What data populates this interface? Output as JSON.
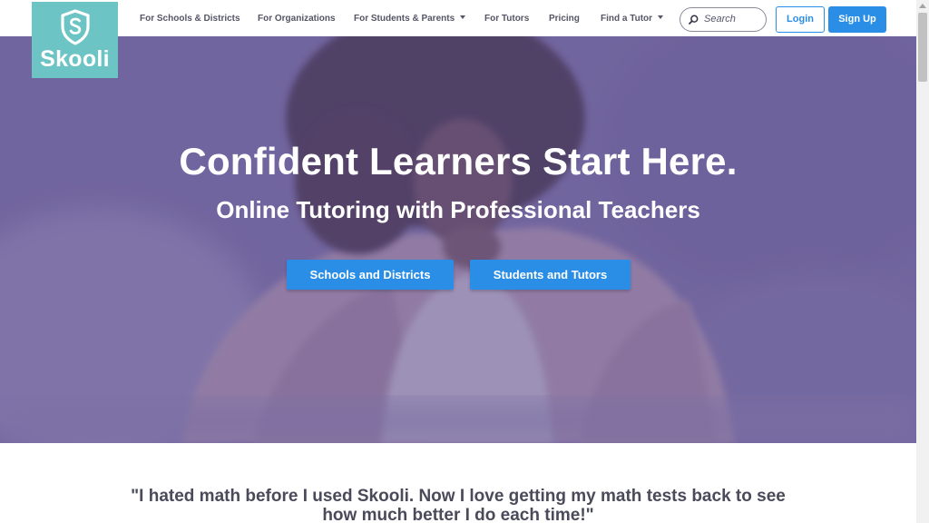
{
  "brand": {
    "name": "Skooli",
    "logo_icon": "shield-s-icon",
    "color": "#6cc4c4"
  },
  "nav": {
    "items": [
      {
        "label": "For Schools & Districts",
        "dropdown": false
      },
      {
        "label": "For Organizations",
        "dropdown": false
      },
      {
        "label": "For Students & Parents",
        "dropdown": true
      },
      {
        "label": "For Tutors",
        "dropdown": false
      },
      {
        "label": "Pricing",
        "dropdown": false
      },
      {
        "label": "Find a Tutor",
        "dropdown": true
      }
    ],
    "search_placeholder": "Search",
    "login_label": "Login",
    "signup_label": "Sign Up"
  },
  "hero": {
    "title": "Confident Learners Start Here.",
    "subtitle": "Online Tutoring with Professional Teachers",
    "buttons": [
      "Schools and Districts",
      "Students and Tutors"
    ]
  },
  "testimonial": {
    "line1": "\"I hated math before I used Skooli. Now I love getting my math tests back to see",
    "line2": "how much better I do each time!\""
  },
  "colors": {
    "accent": "#2b8ee6",
    "hero_overlay": "#6a5e9c",
    "text_dark": "#4a4a5a"
  }
}
